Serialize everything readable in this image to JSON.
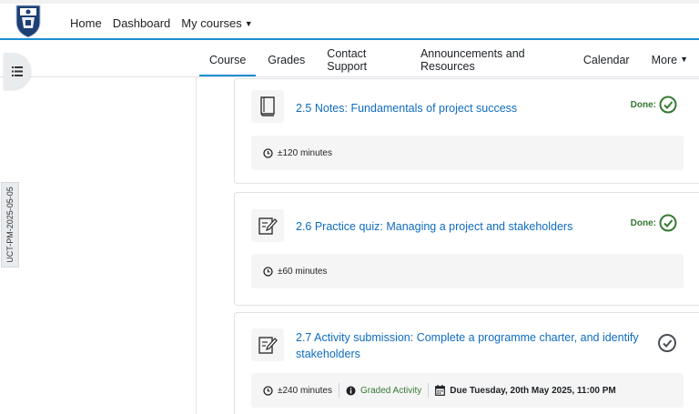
{
  "topnav": {
    "items": [
      "Home",
      "Dashboard",
      "My courses"
    ]
  },
  "secnav": {
    "tabs": [
      "Course",
      "Grades",
      "Contact Support",
      "Announcements and Resources",
      "Calendar",
      "More"
    ]
  },
  "watermark": "UCT-PM-2025-05-05",
  "activities": [
    {
      "title": "2.5 Notes: Fundamentals of project success",
      "status": "Done:",
      "duration": "±120 minutes"
    },
    {
      "title": "2.6 Practice quiz: Managing a project and stakeholders",
      "status": "Done:",
      "duration": "±60 minutes"
    },
    {
      "title": "2.7 Activity submission: Complete a programme charter, and identify stakeholders",
      "duration": "±240 minutes",
      "badge": "Graded Activity",
      "due": "Due Tuesday, 20th May 2025, 11:00 PM"
    }
  ],
  "colors": {
    "accent": "#1a8fd0",
    "link": "#0f6cbf",
    "success": "#357a32"
  }
}
